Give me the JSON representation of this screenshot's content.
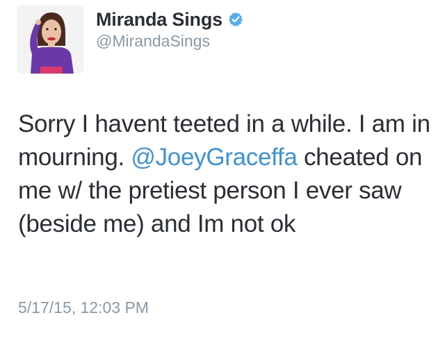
{
  "user": {
    "display_name": "Miranda Sings",
    "handle": "@MirandaSings",
    "verified": true,
    "avatar_icon": "profile-photo"
  },
  "tweet": {
    "text_part1": "Sorry I havent teeted in a while. I am in mourning.",
    "mention": "@JoeyGraceffa",
    "text_part2": "cheated on me w/ the pretiest person I ever saw (beside me) and Im not ok",
    "timestamp": "5/17/15, 12:03 PM"
  },
  "colors": {
    "text": "#292f33",
    "secondary": "#8899a6",
    "link": "#3b94d9",
    "verified_badge": "#55acee"
  }
}
